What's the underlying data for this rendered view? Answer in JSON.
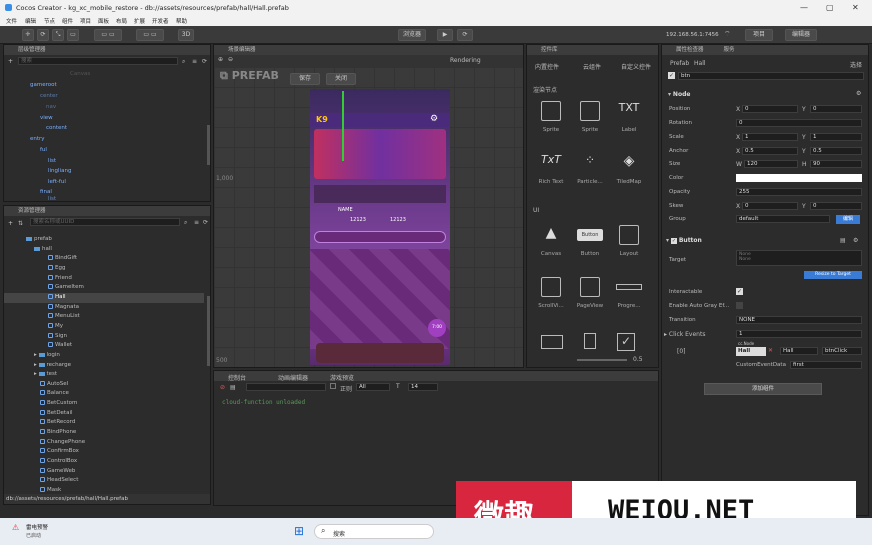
{
  "window": {
    "title": "Cocos Creator - kg_xc_mobile_restore - db://assets/resources/prefab/hall/Hall.prefab",
    "min": "—",
    "max": "▢",
    "close": "✕"
  },
  "menu": [
    "文件",
    "编辑",
    "节点",
    "组件",
    "项目",
    "面板",
    "布局",
    "扩展",
    "开发者",
    "帮助"
  ],
  "toolbar": {
    "mode3d": "3D",
    "preview_mode": "浏览器",
    "ip": "192.168.56.1:7456",
    "project_btn": "项目",
    "editor_btn": "编辑器"
  },
  "hierarchy": {
    "title": "层级管理器",
    "search_placeholder": "搜索",
    "items": [
      "Canvas",
      "gameroot",
      "center",
      "nav",
      "view",
      "content",
      "entry",
      "ful",
      "list",
      "lingliang",
      "left-ful",
      "final",
      "list"
    ]
  },
  "assets": {
    "title": "资源管理器",
    "search_placeholder": "搜索名称或UUID",
    "items": [
      "prefab",
      "hall",
      "BindGift",
      "Egg",
      "Friend",
      "GameItem",
      "Hall",
      "Magnata",
      "MenuList",
      "My",
      "Sign",
      "Wallet",
      "login",
      "recharge",
      "test",
      "AutoSel",
      "Balance",
      "BetCustom",
      "BetDetail",
      "BetRecord",
      "BindPhone",
      "ChangePhone",
      "ConfirmBox",
      "ControlBox",
      "GameWeb",
      "HeadSelect",
      "Mask"
    ],
    "path": "db://assets/resources/prefab/hall/Hall.prefab"
  },
  "scene": {
    "title": "场景编辑器",
    "prefab_label": "PREFAB",
    "save": "保存",
    "close": "关闭",
    "render_mode": "Rendering",
    "ruler_top": "1,000",
    "ruler_bottom": "500",
    "name_label": "NAME",
    "coins1": "12123",
    "coins2": "12123",
    "time_badge": "7:00"
  },
  "console": {
    "tabs": [
      "控制台",
      "动画编辑器",
      "游戏预览"
    ],
    "regex": "正则",
    "filter": "All",
    "font_size": "14",
    "log": "cloud-function unloaded"
  },
  "library": {
    "title": "控件库",
    "tabs": [
      "内置控件",
      "云组件",
      "自定义控件"
    ],
    "section1": "渲染节点",
    "section2": "UI",
    "controls": [
      "Sprite",
      "Sprite",
      "Label",
      "Rich Text",
      "Particle...",
      "TiledMap",
      "Canvas",
      "Button",
      "Layout",
      "ScrollVi...",
      "PageView",
      "Progre..."
    ],
    "label_glyph": "TXT",
    "richtext_glyph": "TxT",
    "button_glyph": "Button",
    "zoom": "0.5"
  },
  "inspector": {
    "title": "属性检查器",
    "tab2": "服务",
    "prefab_label": "Prefab",
    "prefab_name": "Hall",
    "select": "选择",
    "node_name": "btn",
    "node_section": "Node",
    "props": [
      {
        "label": "Position",
        "x": "0",
        "y": "0"
      },
      {
        "label": "Rotation",
        "v": "0"
      },
      {
        "label": "Scale",
        "x": "1",
        "y": "1"
      },
      {
        "label": "Anchor",
        "x": "0.5",
        "y": "0.5"
      },
      {
        "label": "Size",
        "w": "120",
        "h": "90"
      },
      {
        "label": "Color",
        "v": ""
      },
      {
        "label": "Opacity",
        "v": "255"
      },
      {
        "label": "Skew",
        "x": "0",
        "y": "0"
      },
      {
        "label": "Group",
        "v": "default"
      }
    ],
    "edit_btn": "编辑",
    "button_section": "Button",
    "target_label": "Target",
    "target_value": "None",
    "target_none": "None",
    "resize_btn": "Resize to Target",
    "interactable_label": "Interactable",
    "autogray_label": "Enable Auto Gray Ef...",
    "transition_label": "Transition",
    "transition_value": "NONE",
    "click_events_label": "Click Events",
    "click_events_count": "1",
    "event_index": "[0]",
    "cc_node": "cc.Node",
    "event_node": "Hall",
    "event_comp": "Hall",
    "event_handler": "btnClick",
    "custom_data_label": "CustomEventData",
    "custom_data_value": "first",
    "add_component": "添加组件"
  },
  "watermark": {
    "cn": "微趣",
    "en": "WEIQU.NET"
  },
  "taskbar": {
    "weather_title": "雷电预警",
    "weather_sub": "已启动",
    "search": "搜索"
  }
}
